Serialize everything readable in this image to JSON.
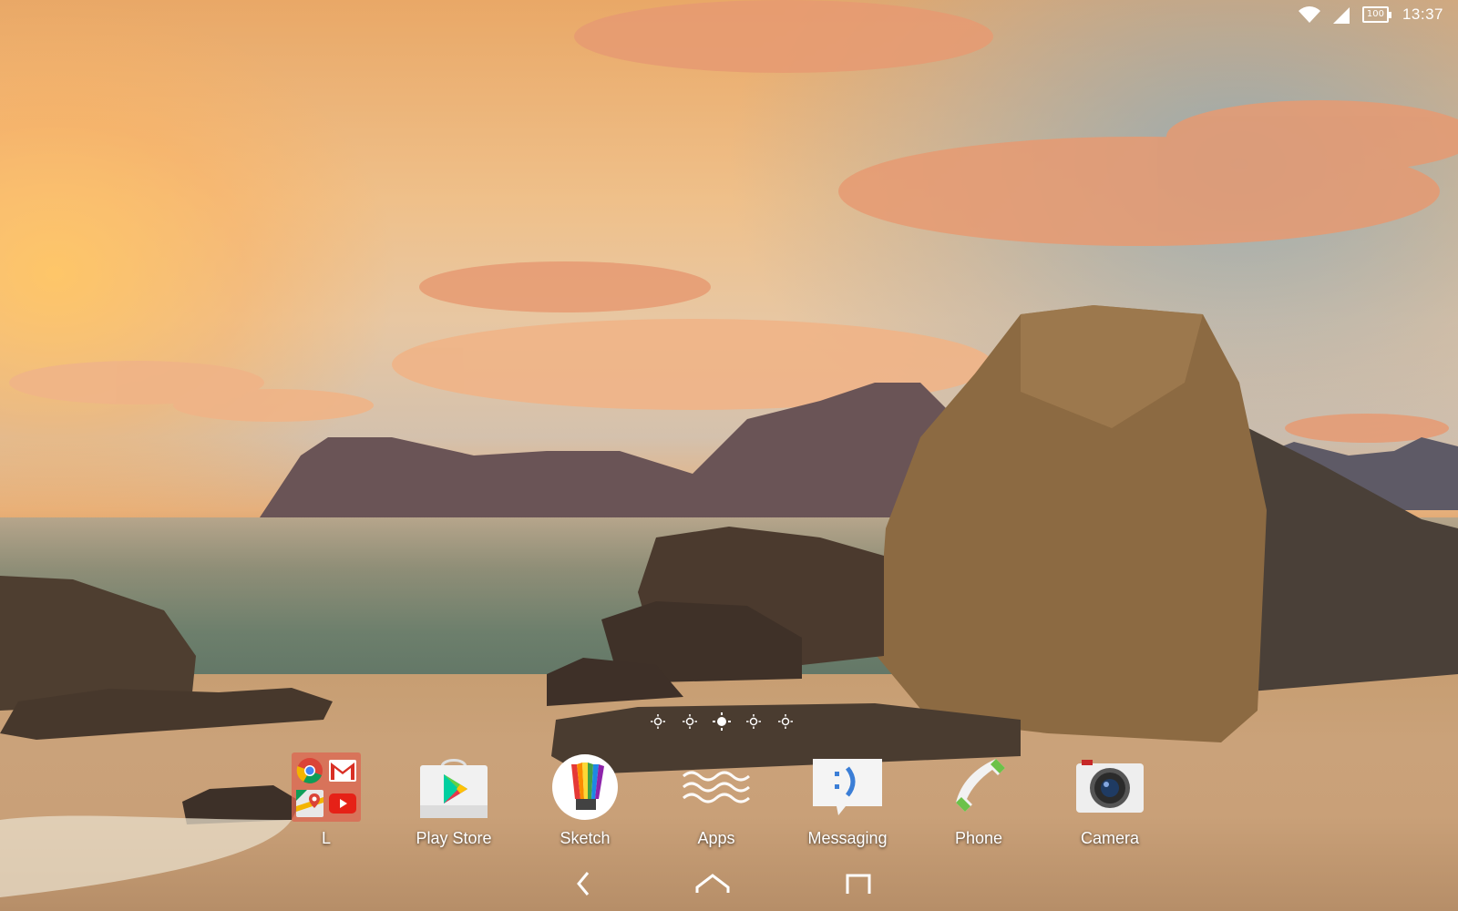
{
  "status_bar": {
    "battery_level": "100",
    "time": "13:37",
    "icons": [
      "wifi-icon",
      "cellular-signal-icon",
      "battery-icon"
    ]
  },
  "page_indicator": {
    "pages": 5,
    "current_page": 3
  },
  "dock": {
    "items": [
      {
        "label": "L",
        "icon": "folder-icon",
        "folder_apps": [
          "chrome-icon",
          "gmail-icon",
          "maps-icon",
          "youtube-icon"
        ]
      },
      {
        "label": "Play Store",
        "icon": "play-store-icon"
      },
      {
        "label": "Sketch",
        "icon": "sketch-icon"
      },
      {
        "label": "Apps",
        "icon": "apps-drawer-icon"
      },
      {
        "label": "Messaging",
        "icon": "messaging-icon"
      },
      {
        "label": "Phone",
        "icon": "phone-icon"
      },
      {
        "label": "Camera",
        "icon": "camera-icon"
      }
    ]
  },
  "nav_bar": {
    "buttons": [
      "back-icon",
      "home-icon",
      "recents-icon"
    ]
  },
  "colors": {
    "folder_bg": "#dc6450",
    "phone_accent": "#6cc24a",
    "text": "#ffffff"
  }
}
